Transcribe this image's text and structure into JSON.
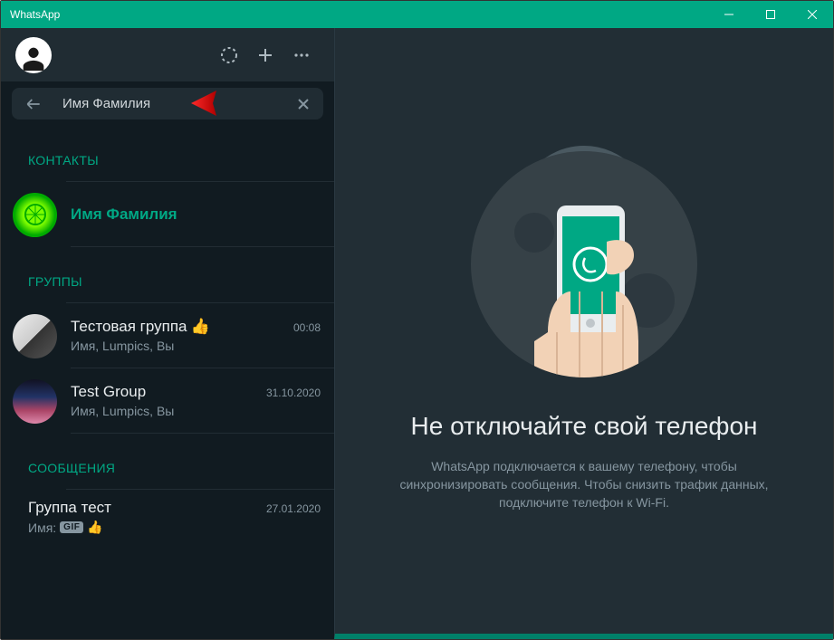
{
  "titlebar": {
    "title": "WhatsApp"
  },
  "search": {
    "value": "Имя Фамилия"
  },
  "sections": {
    "contacts_label": "КОНТАКТЫ",
    "groups_label": "ГРУППЫ",
    "messages_label": "СООБЩЕНИЯ"
  },
  "contact": {
    "name": "Имя Фамилия"
  },
  "group1": {
    "name": "Тестовая группа",
    "emoji": "👍",
    "sub": "Имя, Lumpics, Вы",
    "time": "00:08"
  },
  "group2": {
    "name": "Test Group",
    "sub": "Имя, Lumpics, Вы",
    "time": "31.10.2020"
  },
  "msg1": {
    "name": "Группа тест",
    "sub_prefix": "Имя:",
    "gif": "GIF",
    "emoji": "👍",
    "time": "27.01.2020"
  },
  "main": {
    "title": "Не отключайте свой телефон",
    "desc": "WhatsApp подключается к вашему телефону, чтобы синхронизировать сообщения. Чтобы снизить трафик данных, подключите телефон к Wi-Fi."
  }
}
